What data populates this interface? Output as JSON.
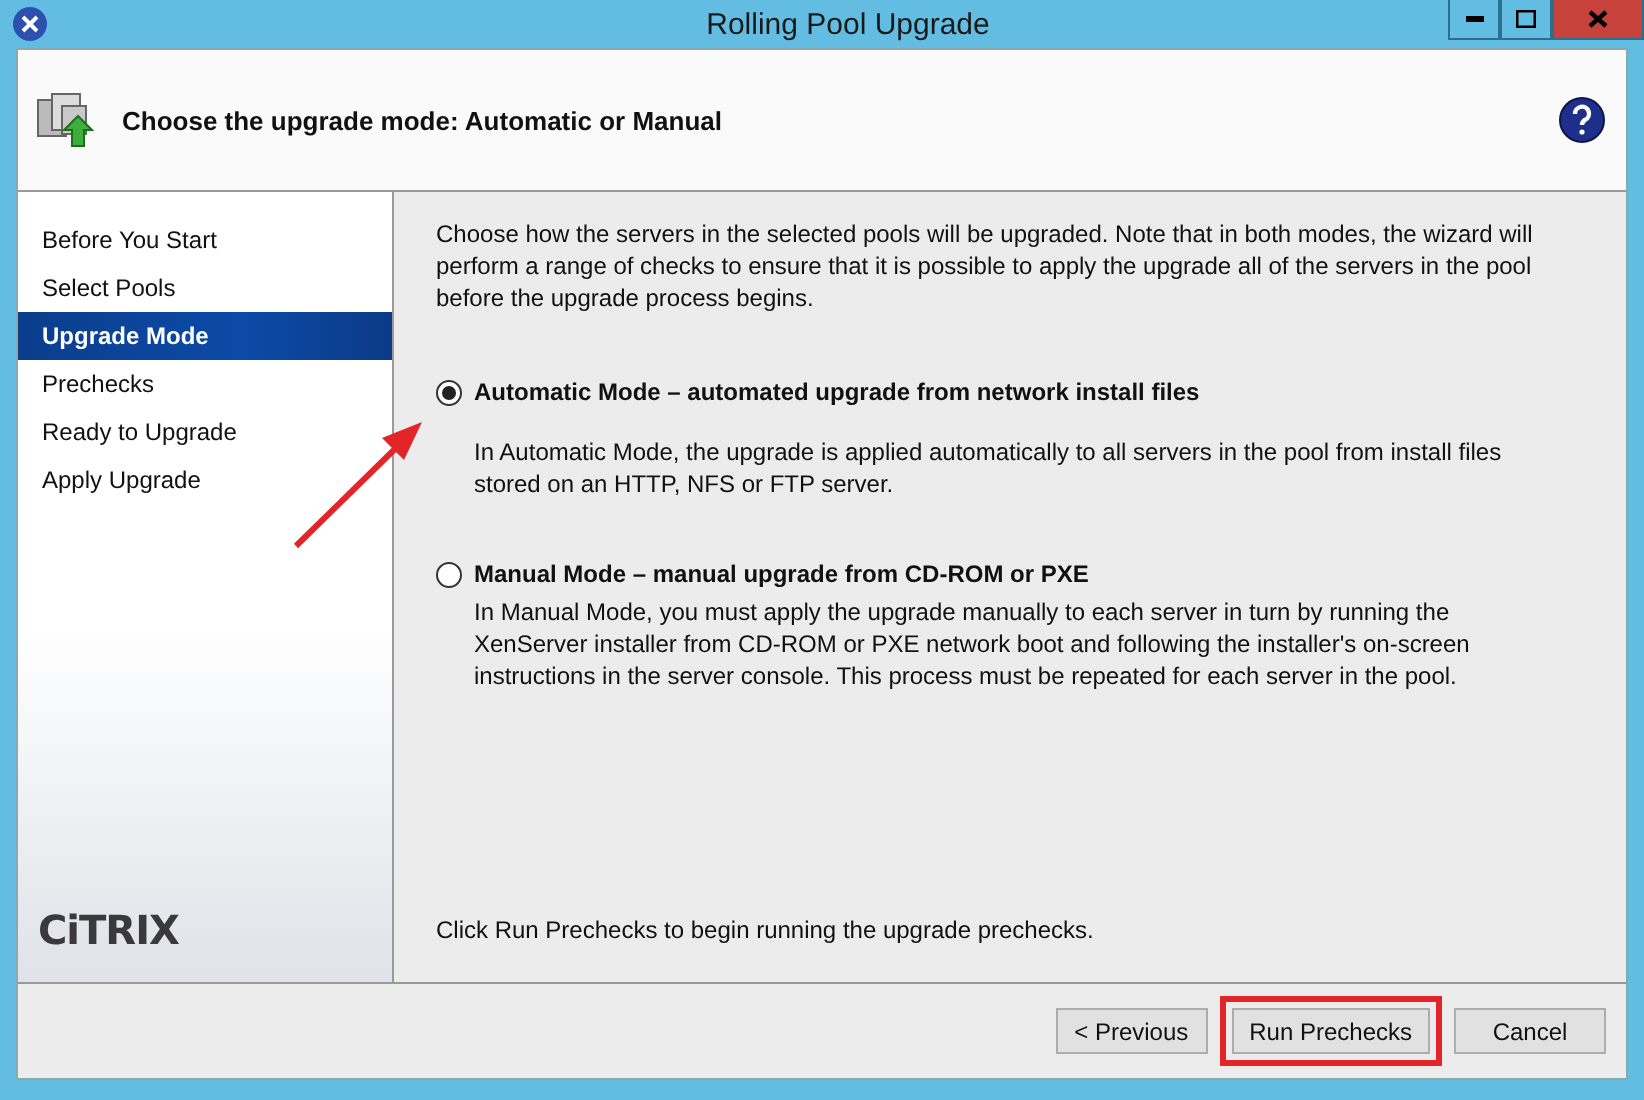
{
  "window": {
    "title": "Rolling Pool Upgrade",
    "controls": [
      {
        "kind": "minimize"
      },
      {
        "kind": "maximize"
      },
      {
        "kind": "close"
      }
    ]
  },
  "header": {
    "title": "Choose the upgrade mode: Automatic or Manual"
  },
  "sidebar": {
    "items": [
      {
        "label": "Before You Start",
        "selected": false
      },
      {
        "label": "Select Pools",
        "selected": false
      },
      {
        "label": "Upgrade Mode",
        "selected": true
      },
      {
        "label": "Prechecks",
        "selected": false
      },
      {
        "label": "Ready to Upgrade",
        "selected": false
      },
      {
        "label": "Apply Upgrade",
        "selected": false
      }
    ],
    "logo": "CiTRIX"
  },
  "intro": "Choose how the servers in the selected pools will be upgraded. Note that in both modes, the wizard will perform a range of checks to ensure that it is possible to apply the upgrade all of the servers in the pool before the upgrade process begins.",
  "modes": [
    {
      "label": "Automatic Mode – automated upgrade from network install files",
      "selected": true,
      "description": "In Automatic Mode, the upgrade is applied automatically to all servers in the pool from install files stored on an HTTP, NFS or FTP server.",
      "annotated": true
    },
    {
      "label": "Manual Mode – manual upgrade from CD-ROM or PXE",
      "selected": false,
      "description": "In Manual Mode, you must apply the upgrade manually to each server in turn by running the XenServer installer from CD-ROM or PXE network boot and following the installer's on-screen instructions in the server console. This process must be repeated for each server in the pool.",
      "annotated": false
    }
  ],
  "footer_note": "Click Run Prechecks to begin running the upgrade prechecks.",
  "buttons": [
    {
      "label": "< Previous",
      "highlighted": false
    },
    {
      "label": "Run Prechecks",
      "highlighted": true
    },
    {
      "label": "Cancel",
      "highlighted": false
    }
  ]
}
